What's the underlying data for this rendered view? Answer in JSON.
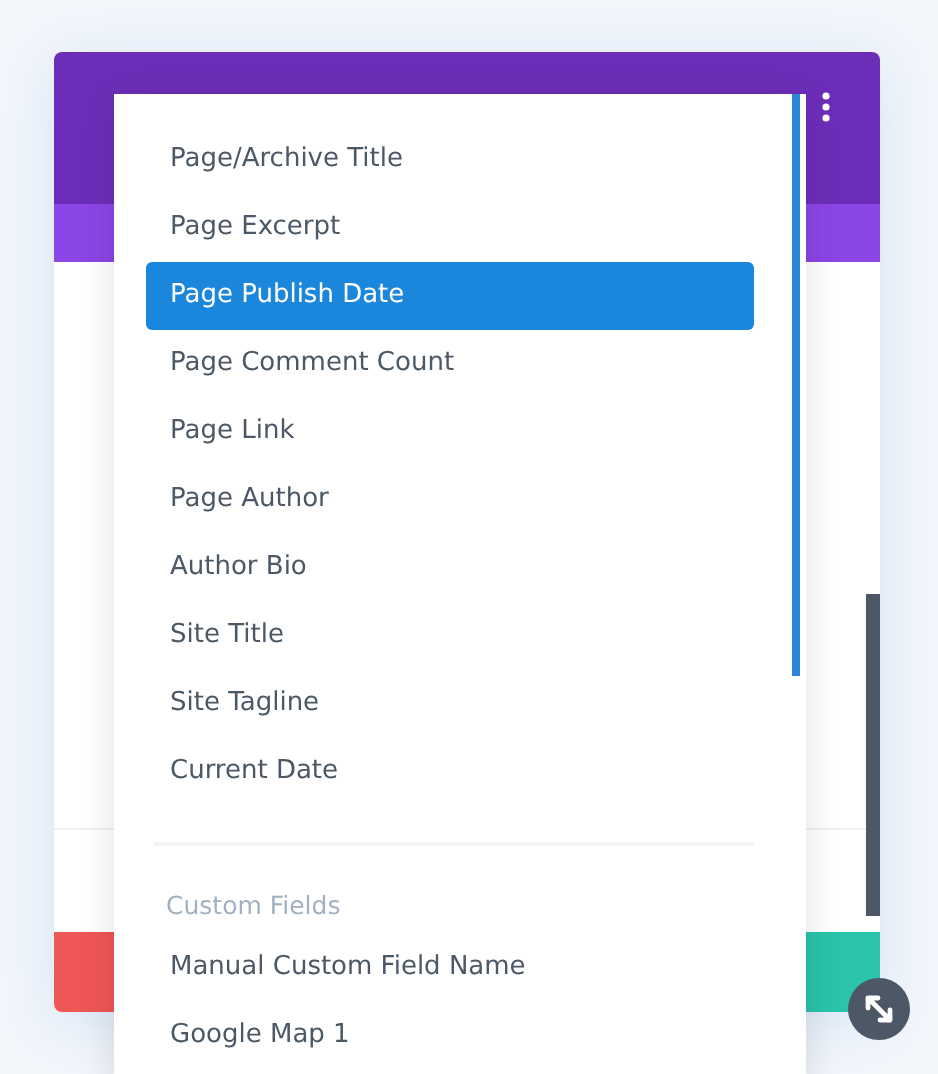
{
  "dynamic_content_menu": {
    "items": [
      {
        "label": "Page/Archive Title",
        "selected": false
      },
      {
        "label": "Page Excerpt",
        "selected": false
      },
      {
        "label": "Page Publish Date",
        "selected": true
      },
      {
        "label": "Page Comment Count",
        "selected": false
      },
      {
        "label": "Page Link",
        "selected": false
      },
      {
        "label": "Page Author",
        "selected": false
      },
      {
        "label": "Author Bio",
        "selected": false
      },
      {
        "label": "Site Title",
        "selected": false
      },
      {
        "label": "Site Tagline",
        "selected": false
      },
      {
        "label": "Current Date",
        "selected": false
      }
    ],
    "groups": [
      {
        "heading": "Custom Fields",
        "items": [
          {
            "label": "Manual Custom Field Name",
            "selected": false
          },
          {
            "label": "Google Map 1",
            "selected": false
          }
        ]
      }
    ]
  }
}
